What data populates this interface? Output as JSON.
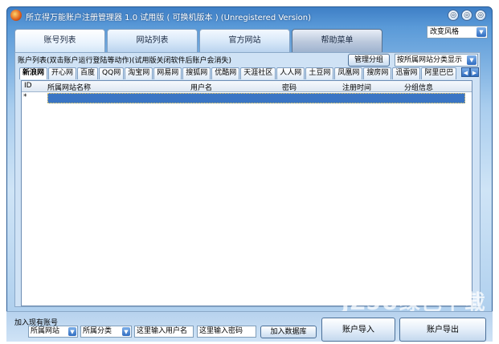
{
  "window": {
    "title": "所立得万能账户注册管理器 1.0  试用版 ( 可换机版本 ) (Unregistered Version)",
    "buttons": [
      "◎",
      "◎",
      "◎"
    ]
  },
  "main_tabs": [
    "账号列表",
    "网站列表",
    "官方网站",
    "帮助菜单"
  ],
  "style_select": "改变风格",
  "hint": "账户列表(双击账户运行登陆等动作)(试用版关闭软件后账户会消失)",
  "manage_group_button": "管理分组",
  "sort_select": "按所属网站分类显示",
  "site_tabs": [
    "新浪网",
    "开心网",
    "百度",
    "QQ网",
    "淘宝网",
    "网易网",
    "搜狐网",
    "优酷网",
    "天涯社区",
    "人人网",
    "土豆网",
    "凤凰网",
    "搜房网",
    "迅雷网",
    "阿里巴巴"
  ],
  "grid": {
    "columns": [
      "ID",
      "所属网站名称",
      "用户名",
      "密码",
      "注册时间",
      "分组信息"
    ],
    "new_row_marker": "*"
  },
  "bottom": {
    "group_label": "加入现有账号",
    "site_combo": "所属网站",
    "category_combo": "所属分类",
    "username_placeholder": "这里输入用户名",
    "password_placeholder": "这里输入密码",
    "add_db_button": "加入数据库",
    "import_button": "账户导入",
    "export_button": "账户导出"
  },
  "watermark": "JZ5U绿色下载"
}
